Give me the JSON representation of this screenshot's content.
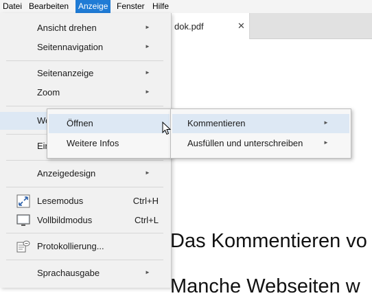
{
  "menubar": {
    "items": [
      {
        "label": "Datei"
      },
      {
        "label": "Bearbeiten"
      },
      {
        "label": "Anzeige"
      },
      {
        "label": "Fenster"
      },
      {
        "label": "Hilfe"
      }
    ],
    "active_index": 2,
    "accent": "#1f7bd5"
  },
  "tab": {
    "title": "dok.pdf",
    "close_glyph": "✕"
  },
  "document": {
    "line1": "Das Kommentieren vo",
    "line2": "Manche Webseiten w"
  },
  "view_menu": {
    "items": [
      {
        "label": "Ansicht drehen",
        "submenu": true
      },
      {
        "label": "Seitennavigation",
        "submenu": true
      },
      {
        "label": "Seitenanzeige",
        "submenu": true
      },
      {
        "label": "Zoom",
        "submenu": true
      },
      {
        "label": "We",
        "submenu": true
      },
      {
        "label": "Ein",
        "submenu": false
      },
      {
        "label": "Anzeigedesign",
        "submenu": true
      },
      {
        "label": "Lesemodus",
        "shortcut": "Ctrl+H",
        "icon": "reading-mode-icon"
      },
      {
        "label": "Vollbildmodus",
        "shortcut": "Ctrl+L",
        "icon": "fullscreen-icon"
      },
      {
        "label": "Protokollierung...",
        "icon": "logging-icon"
      },
      {
        "label": "Sprachausgabe",
        "submenu": true
      }
    ]
  },
  "submenu_web": {
    "items": [
      {
        "label": "Öffnen"
      },
      {
        "label": "Weitere Infos"
      }
    ]
  },
  "submenu_open": {
    "items": [
      {
        "label": "Kommentieren",
        "submenu": true
      },
      {
        "label": "Ausfüllen und unterschreiben",
        "submenu": true
      }
    ]
  },
  "arrow_glyph": "►",
  "highlight_color": "#dde8f4"
}
